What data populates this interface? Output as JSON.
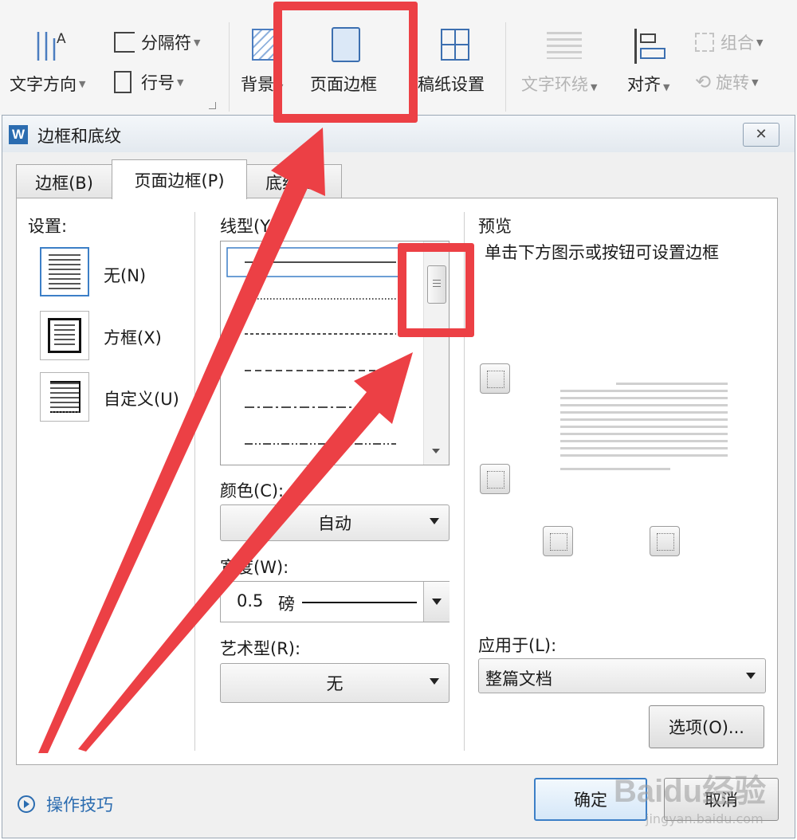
{
  "ribbon": {
    "text_direction": "文字方向",
    "separator": "分隔符",
    "line_number": "行号",
    "background": "背景",
    "page_border": "页面边框",
    "draft_paper": "稿纸设置",
    "text_wrap": "文字环绕",
    "align": "对齐",
    "group": "组合",
    "rotate": "旋转"
  },
  "dialog": {
    "title": "边框和底纹",
    "close_symbol": "✕",
    "tabs": [
      "边框(B)",
      "页面边框(P)",
      "底纹(S)"
    ],
    "active_tab": 1,
    "settings": {
      "heading": "设置:",
      "options": [
        "无(N)",
        "方框(X)",
        "自定义(U)"
      ]
    },
    "line_style_label": "线型(Y):",
    "color": {
      "label": "颜色(C):",
      "value": "自动"
    },
    "width": {
      "label": "宽度(W):",
      "value": "0.5",
      "unit": "磅"
    },
    "art": {
      "label": "艺术型(R):",
      "value": "无"
    },
    "preview": {
      "heading": "预览",
      "hint": "单击下方图示或按钮可设置边框"
    },
    "apply_to": {
      "label": "应用于(L):",
      "value": "整篇文档"
    },
    "options_button": "选项(O)...",
    "ok_button": "确定",
    "cancel_button": "取消",
    "tips_link": "操作技巧"
  },
  "watermark": {
    "brand": "Baidu经验",
    "url": "jingyan.baidu.com"
  },
  "colors": {
    "highlight": "#ec4045",
    "selection_border": "#3c7fc7",
    "tips_link": "#2b6cb0"
  }
}
